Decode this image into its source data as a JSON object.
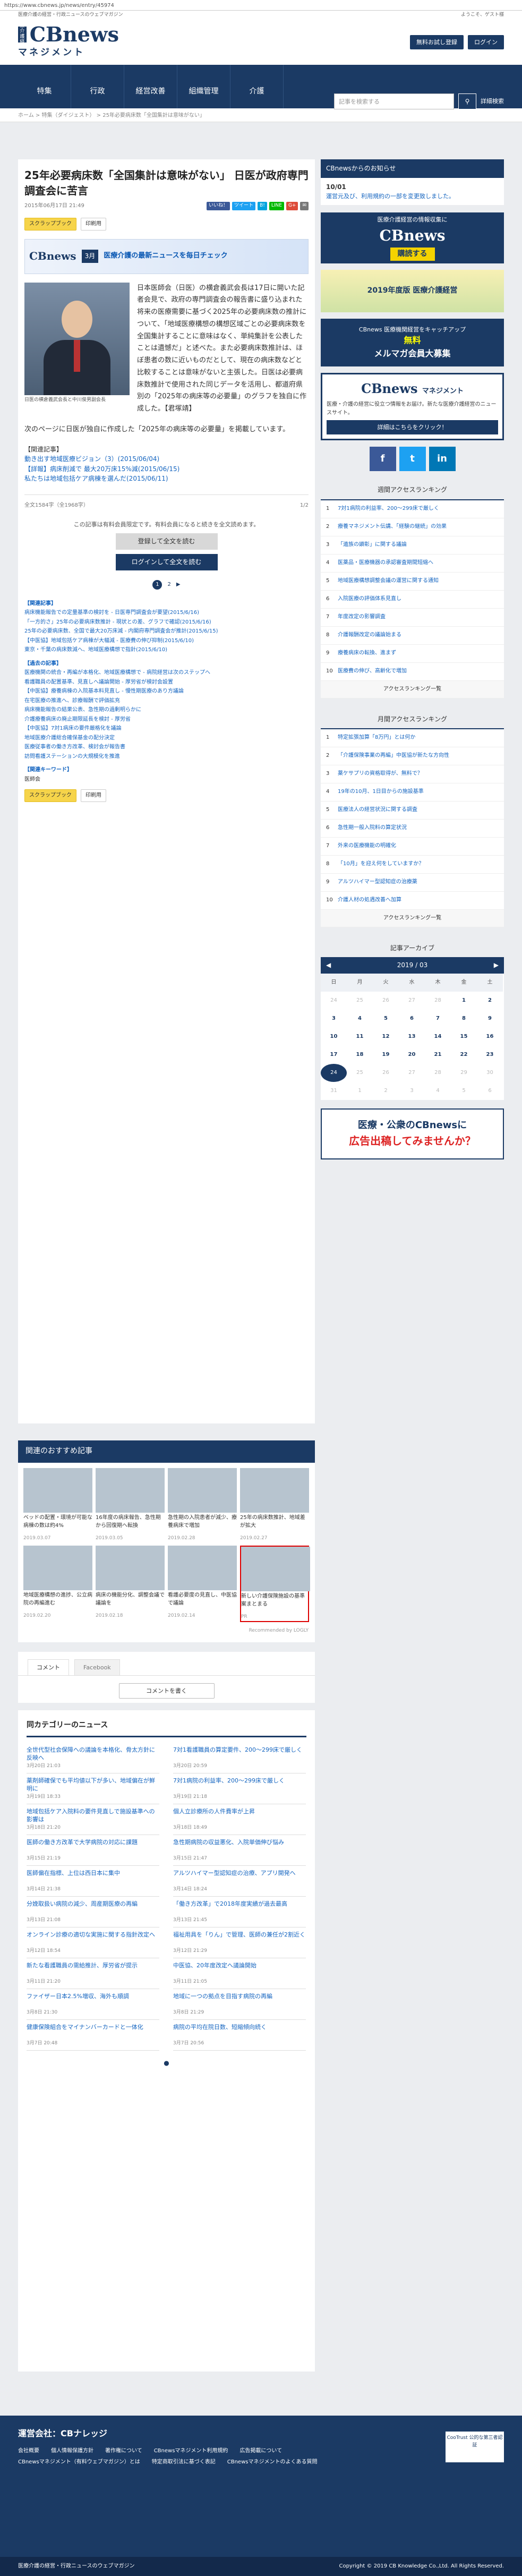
{
  "browser": {
    "url": "https://www.cbnews.jp/news/entry/45974"
  },
  "header": {
    "tagline": "医療介護の経営・行政ニュースのウェブマガジン",
    "greeting": "ようこそ、ゲスト様",
    "logo": {
      "main": "CBnews",
      "sub": "マネジメント",
      "mark": "医療介護経営"
    },
    "trial_button": "無料お試し登録",
    "login_button": "ログイン"
  },
  "nav": {
    "items": [
      "特集",
      "行政",
      "経営改善",
      "組織管理",
      "介護"
    ],
    "search_placeholder": "記事を検索する",
    "advanced_search": "詳細検索"
  },
  "breadcrumb": [
    "ホーム",
    "特集（ダイジェスト）",
    "25年必要病床数「全国集計は意味がない」"
  ],
  "article": {
    "title": "25年必要病床数「全国集計は意味がない」 日医が政府専門調査会に苦言",
    "date": "2015年06月17日 21:49",
    "share": [
      "いいね！",
      "ツイート",
      "B!",
      "LINE",
      "G+",
      "✉"
    ],
    "chips": [
      "スクラップブック",
      "印刷用"
    ],
    "banner": {
      "brand": "CBnews",
      "month": "3月",
      "text": "医療介護の最新ニュースを毎日チェック"
    },
    "photo_caption": "日医の横倉義武会長と中川俊男副会長",
    "paragraphs": [
      "日本医師会（日医）の横倉義武会長は17日に開いた記者会見で、政府の専門調査会の報告書に盛り込まれた将来の医療需要に基づく2025年の必要病床数の推計について、「地域医療構想の構想区域ごとの必要病床数を全国集計することに意味はなく、単純集計を公表したことは遺憾だ」と述べた。また必要病床数推計は、ほぼ患者の数に近いものだとして、現在の病床数などと比較することは意味がないと主張した。日医は必要病床数推計で使用された同じデータを活用し、都道府県別の「2025年の病床等の必要量」のグラフを独自に作成した。【君塚靖】",
      "次のページに日医が独自に作成した「2025年の病床等の必要量」を掲載しています。"
    ],
    "related": {
      "title": "【関連記事】",
      "links": [
        "動き出す地域医療ビジョン（3）(2015/06/04)",
        "【詳報】病床削減で 最大20万床15%減(2015/06/15)",
        "私たちは地域包括ケア病棟を選んだ(2015/06/11)"
      ]
    },
    "pay": {
      "count": "全文1584字（全1968字）",
      "page": "1/2",
      "msg": "この記事は有料会員限定です。有料会員になると続きを全文読めます。",
      "trial": "登録して全文を読む",
      "login": "ログインして全文を読む"
    },
    "pages": [
      "1",
      "2",
      "▶"
    ],
    "link_groups": [
      {
        "head": "【関連記事】",
        "items": [
          "病床機能報告での定量基準の検討を - 日医専門調査会が要望(2015/6/16)",
          "「一方的さ」25年の必要病床数推計 - 現状との差、グラフで確認(2015/6/16)",
          "25年の必要病床数、全国で最大20万床減 - 内閣府専門調査会が推計(2015/6/15)",
          "【中医協】地域包括ケア病棟が大幅減 - 医療費の伸び抑制(2015/6/10)",
          "東京・千葉の病床数減へ、地域医療構想で指針(2015/6/10)"
        ]
      },
      {
        "head": "【過去の記事】",
        "items": [
          "医療機関の統合・再編が本格化、地域医療構想で - 病院経営は次のステップへ",
          "看護職員の配置基準、見直しへ議論開始 - 厚労省が検討会設置",
          "【中医協】療養病棟の入院基本料見直し - 慢性期医療のあり方議論",
          "在宅医療の推進へ、診療報酬で評価拡充",
          "病床機能報告の結果公表、急性期の過剰明らかに",
          "介護療養病床の廃止期限延長を検討 - 厚労省",
          "【中医協】7対1病床の要件厳格化を議論",
          "地域医療介護総合確保基金の配分決定",
          "医療従事者の働き方改革、検討会が報告書",
          "訪問看護ステーションの大規模化を推進"
        ]
      },
      {
        "head": "【関連キーワード】",
        "items": [
          "医師会"
        ]
      }
    ]
  },
  "recommend": {
    "title": "関連のおすすめ記事",
    "cards": [
      {
        "title": "ベッドの配置・環境が可能な病棟の数は約4%",
        "date": "2019.03.07"
      },
      {
        "title": "16年度の病床報告、急性期から回復期へ転換",
        "date": "2019.03.05"
      },
      {
        "title": "急性期の入院患者が減少、療養病床で増加",
        "date": "2019.02.28"
      },
      {
        "title": "25年の病床数推計、地域差が拡大",
        "date": "2019.02.27"
      },
      {
        "title": "地域医療構想の進捗、公立病院の再編進む",
        "date": "2019.02.20"
      },
      {
        "title": "病床の機能分化、調整会議で議論を",
        "date": "2019.02.18"
      },
      {
        "title": "看護必要度の見直し、中医協で議論",
        "date": "2019.02.14"
      },
      {
        "title": "新しい介護保険施設の基準案まとまる",
        "date": "PR"
      }
    ],
    "foot": "Recommended by LOGLY"
  },
  "comments": {
    "tab_comment": "コメント",
    "tab_facebook": "Facebook",
    "more": "コメントを書く"
  },
  "news_section": {
    "title": "同カテゴリーのニュース",
    "left": [
      {
        "title": "全世代型社会保障への議論を本格化、骨太方針に反映へ",
        "date": "3月20日 21:03"
      },
      {
        "title": "薬剤師確保でも平均値以下が多い、地域偏在が鮮明に",
        "date": "3月19日 18:33"
      },
      {
        "title": "地域包括ケア入院料の要件見直しで施設基準への影響は",
        "date": "3月18日 21:20"
      },
      {
        "title": "医師の働き方改革で大学病院の対応に課題",
        "date": "3月15日 21:19"
      },
      {
        "title": "医師偏在指標、上位は西日本に集中",
        "date": "3月14日 21:38"
      },
      {
        "title": "分娩取扱い病院の減少、周産期医療の再編",
        "date": "3月13日 21:08"
      },
      {
        "title": "オンライン診療の適切な実施に関する指針改定へ",
        "date": "3月12日 18:54"
      },
      {
        "title": "新たな看護職員の需給推計、厚労省が提示",
        "date": "3月11日 21:20"
      },
      {
        "title": "ファイザー日本2.5%増収、海外も順調",
        "date": "3月8日 21:30"
      },
      {
        "title": "健康保険組合をマイナンバーカードと一体化",
        "date": "3月7日 20:48"
      }
    ],
    "right": [
      {
        "title": "7対1看護職員の算定要件、200～299床で厳しく",
        "date": "3月20日 20:59"
      },
      {
        "title": "7対1病院の利益率、200～299床で厳しく",
        "date": "3月19日 21:18"
      },
      {
        "title": "個人立診療所の人件費率が上昇",
        "date": "3月18日 18:49"
      },
      {
        "title": "急性期病院の収益悪化、入院単価伸び悩み",
        "date": "3月15日 21:47"
      },
      {
        "title": "アルツハイマー型認知症の治療、アプリ開発へ",
        "date": "3月14日 18:24"
      },
      {
        "title": "「働き方改革」で2018年度実績が過去最高",
        "date": "3月13日 21:45"
      },
      {
        "title": "福祉用具を「りん」で管理、医師の兼任が2割近く",
        "date": "3月12日 21:29"
      },
      {
        "title": "中医協、20年度改定へ議論開始",
        "date": "3月11日 21:05"
      },
      {
        "title": "地域に一つの拠点を目指す病院の再編",
        "date": "3月8日 21:29"
      },
      {
        "title": "病院の平均在院日数、短縮傾向続く",
        "date": "3月7日 20:56"
      }
    ]
  },
  "sidebar": {
    "notice": {
      "title": "CBnewsからのお知らせ",
      "date": "10/01",
      "text": "運営元及び、利用規約の一部を変更致しました。"
    },
    "ad1": {
      "text": "医療介護経営の情報収集に",
      "brand": "CBnews",
      "btn": "購読する"
    },
    "ad2": {
      "text": "2019年度版 医療介護経営"
    },
    "ad3": {
      "t1": "CBnews 医療機関経営をキャッチアップ",
      "t2": "無料",
      "t3": "メルマガ会員大募集"
    },
    "magazine": {
      "title": "CBnews",
      "sub": "マネジメント",
      "desc": "医療・介護の経営に役立つ情報をお届け。新たな医療介護経営のニュースサイト。",
      "btn": "詳細はこちらをクリック！"
    },
    "social": [
      "f",
      "t",
      "in"
    ],
    "weekly": {
      "title": "週間アクセスランキング",
      "items": [
        "7対1病院の利益率、200～299床で厳しく",
        "療養マネジメント伝講、「経験の継続」の効果",
        "「遺族の顕彰」に関する議論",
        "医薬品・医療機器の承認審査期間短縮へ",
        "地域医療構想調整会議の運営に関する通知",
        "入院医療の評価体系見直し",
        "年度改定の影響調査",
        "介護報酬改定の議論始まる",
        "療養病床の転換、進まず",
        "医療費の伸び、高齢化で増加"
      ],
      "more": "アクセスランキング一覧"
    },
    "monthly": {
      "title": "月間アクセスランキング",
      "items": [
        "特定拡張加算「8万円」とは何か",
        "「介護保険事業の再編」中医協が新たな方向性",
        "薬ケサプリの資格取得が、無料で？",
        "19年の10月、1日目からの施設基準",
        "医療法人の経営状況に関する調査",
        "急性期一般入院料の算定状況",
        "外来の医療機能の明確化",
        "「10月」を迎え何をしていますか？",
        "アルツハイマー型認知症の治療薬",
        "介護人材の処遇改善へ加算"
      ],
      "more": "アクセスランキング一覧"
    },
    "archive": {
      "title": "記事アーカイブ",
      "month": "2019 / 03",
      "prev": "◀",
      "next": "▶",
      "weekdays": [
        "日",
        "月",
        "火",
        "水",
        "木",
        "金",
        "土"
      ],
      "weeks": [
        [
          "24",
          "25",
          "26",
          "27",
          "28",
          "1",
          "2"
        ],
        [
          "3",
          "4",
          "5",
          "6",
          "7",
          "8",
          "9"
        ],
        [
          "10",
          "11",
          "12",
          "13",
          "14",
          "15",
          "16"
        ],
        [
          "17",
          "18",
          "19",
          "20",
          "21",
          "22",
          "23"
        ],
        [
          "24",
          "25",
          "26",
          "27",
          "28",
          "29",
          "30"
        ],
        [
          "31",
          "1",
          "2",
          "3",
          "4",
          "5",
          "6"
        ]
      ]
    },
    "ad4": {
      "t1": "医療・公衆のCBnewsに",
      "t2": "広告出稿してみませんか？"
    }
  },
  "footer": {
    "title": "運営会社：CBナレッジ",
    "links": [
      "会社概要",
      "個人情報保護方針",
      "著作権について",
      "CBnewsマネジメント利用規約",
      "広告掲載について",
      "CBnewsマネジメント（有料ウェブマガジン）とは",
      "特定商取引法に基づく表記",
      "CBnewsマネジメントのよくある質問"
    ],
    "seal": "CooTrust 公的な第三者認証",
    "note": "医療介護の経営・行政ニュースのウェブマガジン",
    "copyright": "Copyright © 2019 CB Knowledge Co.,Ltd. All Rights Reserved."
  }
}
